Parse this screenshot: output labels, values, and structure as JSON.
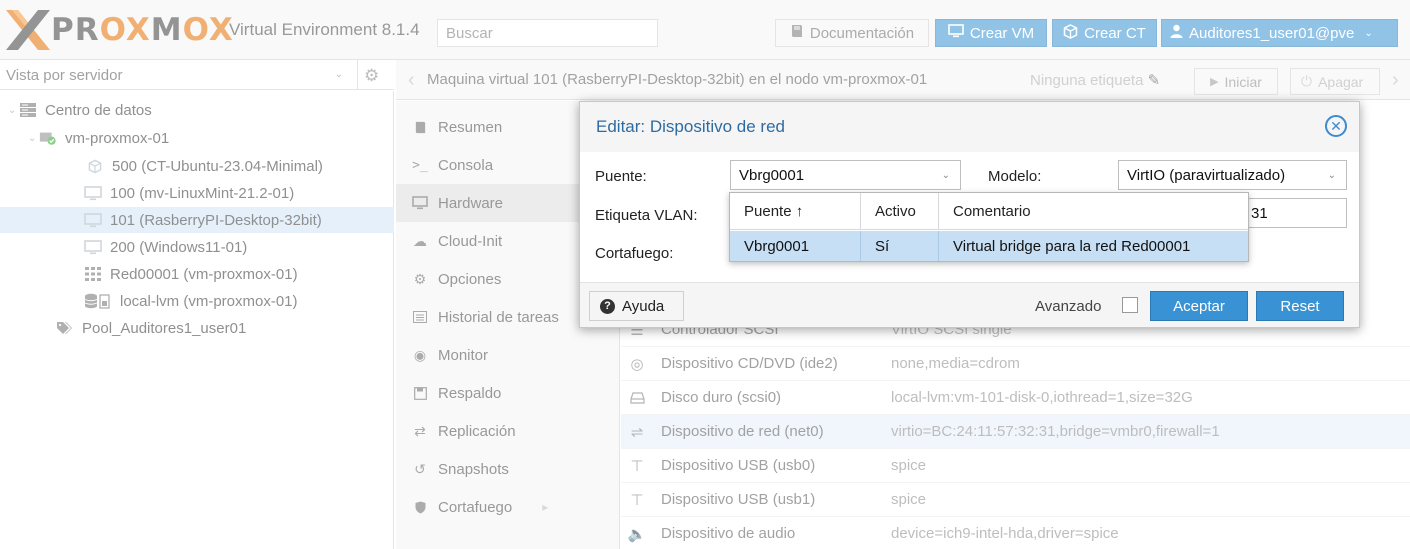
{
  "app": {
    "logo_text": "PROXMOX",
    "version": "Virtual Environment 8.1.4",
    "search_placeholder": "Buscar",
    "doc_label": "Documentación",
    "create_vm_label": "Crear VM",
    "create_ct_label": "Crear CT",
    "user_label": "Auditores1_user01@pve"
  },
  "colors": {
    "accent": "#3892d3",
    "brand_orange": "#e57000",
    "selected_row": "#c6dff5"
  },
  "tree": {
    "view_label": "Vista por servidor",
    "items": [
      {
        "label": "Centro de datos",
        "icon": "datacenter-icon"
      },
      {
        "label": "vm-proxmox-01",
        "icon": "node-icon"
      },
      {
        "label": "500 (CT-Ubuntu-23.04-Minimal)",
        "icon": "container-icon"
      },
      {
        "label": "100 (mv-LinuxMint-21.2-01)",
        "icon": "vm-icon"
      },
      {
        "label": "101 (RasberryPI-Desktop-32bit)",
        "icon": "vm-icon"
      },
      {
        "label": "200 (Windows11-01)",
        "icon": "vm-icon"
      },
      {
        "label": "Red00001 (vm-proxmox-01)",
        "icon": "network-zone-icon"
      },
      {
        "label": "local-lvm (vm-proxmox-01)",
        "icon": "storage-icon"
      },
      {
        "label": "Pool_Auditores1_user01",
        "icon": "pool-tag-icon"
      }
    ]
  },
  "main": {
    "title": "Maquina virtual 101 (RasberryPI-Desktop-32bit) en el nodo vm-proxmox-01",
    "tags_label": "Ninguna etiqueta",
    "start_label": "Iniciar",
    "shutdown_label": "Apagar"
  },
  "menu": {
    "items": [
      {
        "label": "Resumen",
        "icon": "book-icon"
      },
      {
        "label": "Consola",
        "icon": "terminal-icon"
      },
      {
        "label": "Hardware",
        "icon": "desktop-icon"
      },
      {
        "label": "Cloud-Init",
        "icon": "cloud-icon"
      },
      {
        "label": "Opciones",
        "icon": "gear-icon"
      },
      {
        "label": "Historial de tareas",
        "icon": "list-icon"
      },
      {
        "label": "Monitor",
        "icon": "eye-icon"
      },
      {
        "label": "Respaldo",
        "icon": "floppy-icon"
      },
      {
        "label": "Replicación",
        "icon": "retweet-icon"
      },
      {
        "label": "Snapshots",
        "icon": "history-icon"
      },
      {
        "label": "Cortafuego",
        "icon": "shield-icon"
      }
    ]
  },
  "hardware": {
    "rows": [
      {
        "name": "Controlador SCSI",
        "value": "VirtIO SCSI single",
        "icon": "database-icon"
      },
      {
        "name": "Dispositivo CD/DVD (ide2)",
        "value": "none,media=cdrom",
        "icon": "cdrom-icon"
      },
      {
        "name": "Disco duro (scsi0)",
        "value": "local-lvm:vm-101-disk-0,iothread=1,size=32G",
        "icon": "harddisk-icon"
      },
      {
        "name": "Dispositivo de red (net0)",
        "value": "virtio=BC:24:11:57:32:31,bridge=vmbr0,firewall=1",
        "icon": "exchange-icon"
      },
      {
        "name": "Dispositivo USB (usb0)",
        "value": "spice",
        "icon": "usb-icon"
      },
      {
        "name": "Dispositivo USB (usb1)",
        "value": "spice",
        "icon": "usb-icon"
      },
      {
        "name": "Dispositivo de audio",
        "value": "device=ich9-intel-hda,driver=spice",
        "icon": "volume-icon"
      }
    ]
  },
  "dialog": {
    "title": "Editar: Dispositivo de red",
    "bridge_label": "Puente:",
    "bridge_value": "Vbrg0001",
    "model_label": "Modelo:",
    "model_value": "VirtIO (paravirtualizado)",
    "vlan_label": "Etiqueta VLAN:",
    "mac_partial": "31",
    "firewall_label": "Cortafuego:",
    "help_label": "Ayuda",
    "advanced_label": "Avanzado",
    "ok_label": "Aceptar",
    "reset_label": "Reset"
  },
  "picker": {
    "columns": [
      "Puente ↑",
      "Activo",
      "Comentario"
    ],
    "rows": [
      {
        "bridge": "Vbrg0001",
        "active": "Sí",
        "comment": "Virtual bridge para la red Red00001"
      }
    ]
  }
}
